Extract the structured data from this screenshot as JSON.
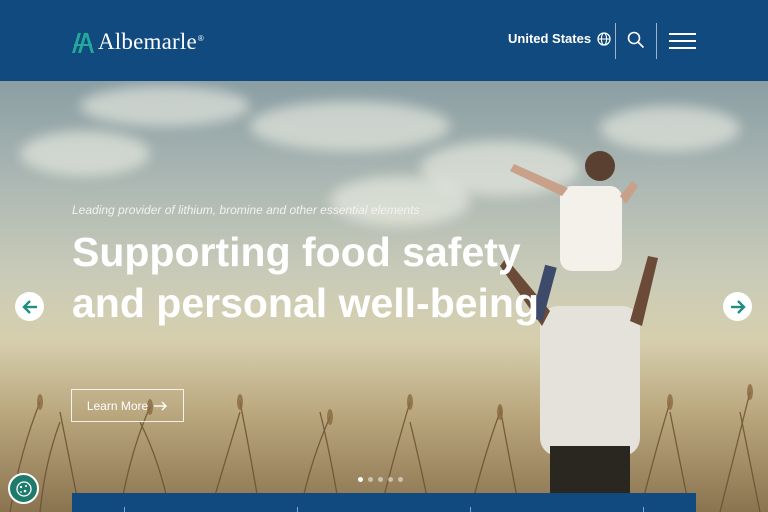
{
  "header": {
    "logo_text": "Albemarle",
    "logo_reg": "®",
    "region_label": "United States"
  },
  "hero": {
    "tagline": "Leading provider of lithium, bromine and other essential elements",
    "headline": "Supporting food safety and personal well-being",
    "cta_label": "Learn More",
    "slide_count": 5,
    "active_slide": 1
  },
  "icons": {
    "logo_mark": "albemarle-logo-mark",
    "globe": "globe-icon",
    "search": "search-icon",
    "menu": "hamburger-menu-icon",
    "prev": "arrow-left-icon",
    "next": "arrow-right-icon",
    "cta_arrow": "arrow-right-icon",
    "cookie": "cookie-settings-icon"
  },
  "colors": {
    "brand_blue": "#114a7f",
    "accent_teal": "#1e8f82",
    "cookie_green": "#1e7a6a"
  }
}
